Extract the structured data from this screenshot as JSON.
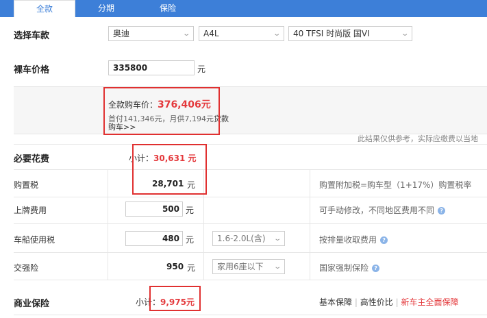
{
  "tabs": [
    "全款",
    "分期",
    "保险"
  ],
  "select_car": {
    "label": "选择车款",
    "brand": "奥迪",
    "model": "A4L",
    "trim": "40 TFSI 时尚版 国VI"
  },
  "bare_price": {
    "label": "裸车价格",
    "value": "335800",
    "unit": "元"
  },
  "summary": {
    "total_label": "全款购车价：",
    "total_value": "376,406元",
    "loan_line": "首付141,346元，月供7,194元",
    "loan_link": "贷款",
    "buy_link": "购车>>",
    "disclaimer": "此结果仅供参考，实际应缴费以当地"
  },
  "necessary": {
    "label": "必要花费",
    "subtotal_label": "小计：",
    "subtotal_value": "30,631 元",
    "rows": [
      {
        "name": "购置税",
        "value": "28,701",
        "unit": "元",
        "note": "购置附加税=购车型（1+17%）购置税率"
      },
      {
        "name": "上牌费用",
        "value": "500",
        "unit": "元",
        "note": "可手动修改，不同地区费用不同"
      },
      {
        "name": "车船使用税",
        "value": "480",
        "unit": "元",
        "option": "1.6-2.0L(含)",
        "note": "按排量收取费用"
      },
      {
        "name": "交强险",
        "value": "950",
        "unit": "元",
        "option": "家用6座以下",
        "note": "国家强制保险"
      }
    ]
  },
  "commercial": {
    "label": "商业保险",
    "subtotal_label": "小计：",
    "subtotal_value": "9,975元",
    "link_basic": "基本保障",
    "divider": "|",
    "link_value": "高性价比",
    "link_full": "新车主全面保障",
    "link_full_color": "#e4393c"
  },
  "icons": {
    "help": "help-circle-icon",
    "chevron": "chevron-down-icon"
  }
}
